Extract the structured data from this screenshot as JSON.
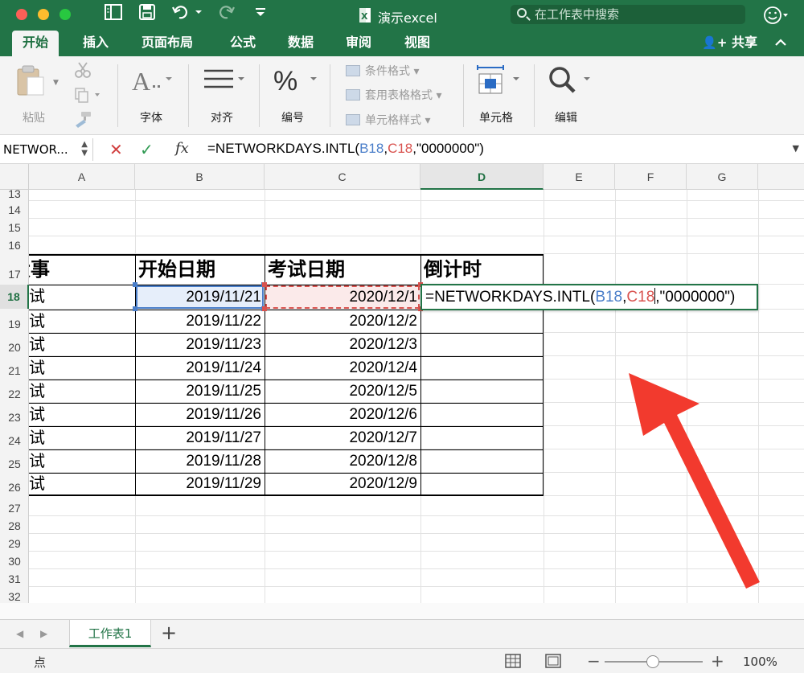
{
  "window": {
    "title": "演示excel",
    "search_placeholder": "在工作表中搜索"
  },
  "ribbon": {
    "tabs": [
      "开始",
      "插入",
      "页面布局",
      "公式",
      "数据",
      "审阅",
      "视图"
    ],
    "share": "共享",
    "groups": {
      "paste": "粘贴",
      "font": "字体",
      "align": "对齐",
      "number": "编号",
      "conditional": "条件格式",
      "table_format": "套用表格格式",
      "cell_styles": "单元格样式",
      "cells": "单元格",
      "edit": "编辑"
    }
  },
  "formula_bar": {
    "name_box": "NETWOR...",
    "fx": "fx",
    "prefix": "=NETWORKDAYS.INTL(",
    "ref1": "B18",
    "comma1": ",",
    "ref2": "C18",
    "suffix": ",\"0000000\")"
  },
  "grid": {
    "columns": [
      "A",
      "B",
      "C",
      "D",
      "E",
      "F",
      "G"
    ],
    "selected_column": "D",
    "rows": [
      "13",
      "14",
      "15",
      "16",
      "17",
      "18",
      "19",
      "20",
      "21",
      "22",
      "23",
      "24",
      "25",
      "26",
      "27",
      "28",
      "29",
      "30",
      "31",
      "32"
    ],
    "selected_row": "18",
    "headers": {
      "a": "大事",
      "b": "开始日期",
      "c": "考试日期",
      "d": "倒计时"
    },
    "a_values": [
      "试",
      "试",
      "试",
      "试",
      "试",
      "试",
      "试",
      "试",
      "试"
    ],
    "b_values": [
      "2019/11/21",
      "2019/11/22",
      "2019/11/23",
      "2019/11/24",
      "2019/11/25",
      "2019/11/26",
      "2019/11/27",
      "2019/11/28",
      "2019/11/29"
    ],
    "c_values": [
      "2020/12/1",
      "2020/12/2",
      "2020/12/3",
      "2020/12/4",
      "2020/12/5",
      "2020/12/6",
      "2020/12/7",
      "2020/12/8",
      "2020/12/9"
    ],
    "editing": {
      "prefix": "=NETWORKDAYS.INTL(",
      "ref1": "B18",
      "comma": ",",
      "ref2": "C18",
      "suffix": ",\"0000000\")"
    }
  },
  "sheet_tabs": [
    "工作表1"
  ],
  "status": {
    "mode": "点",
    "zoom": "100%"
  },
  "colors": {
    "excel_green": "#227447",
    "ref_blue": "#4a7ec9",
    "ref_red": "#d9534f",
    "arrow_red": "#f23a2e"
  }
}
